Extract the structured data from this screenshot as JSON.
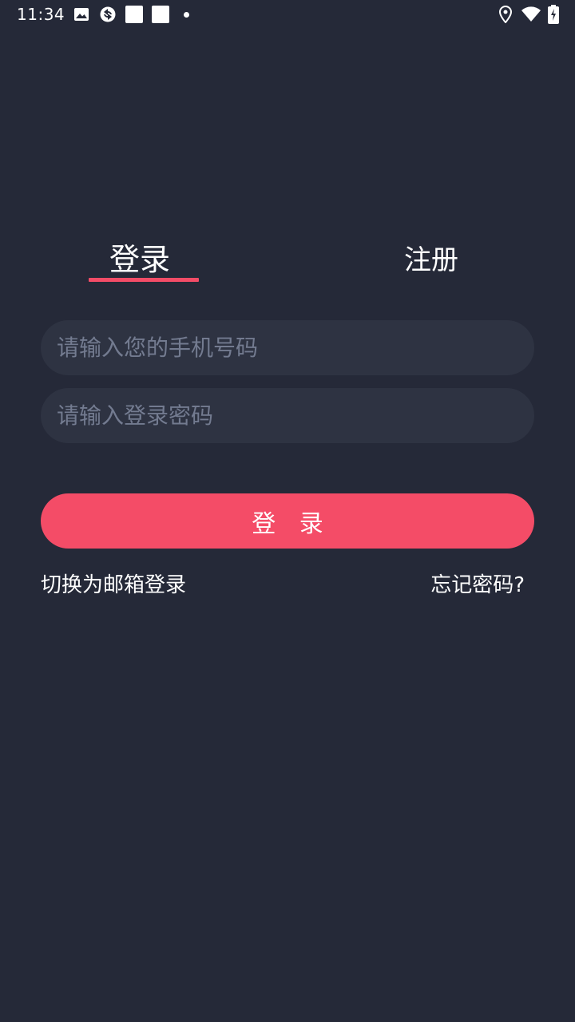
{
  "status_bar": {
    "time": "11:34",
    "icons": [
      "image-icon",
      "sync-icon",
      "notification-square-icon",
      "notification-square-icon",
      "dot-icon",
      "location-icon",
      "wifi-icon",
      "battery-charging-icon"
    ]
  },
  "tabs": {
    "login_label": "登录",
    "register_label": "注册",
    "active": "login"
  },
  "form": {
    "phone_placeholder": "请输入您的手机号码",
    "phone_value": "",
    "password_placeholder": "请输入登录密码",
    "password_value": "",
    "submit_label": "登 录"
  },
  "links": {
    "switch_email": "切换为邮箱登录",
    "forgot_password": "忘记密码?"
  },
  "colors": {
    "background": "#252938",
    "input_background": "#2e3342",
    "accent": "#f44c67",
    "placeholder": "#737b90",
    "text": "#ffffff"
  }
}
